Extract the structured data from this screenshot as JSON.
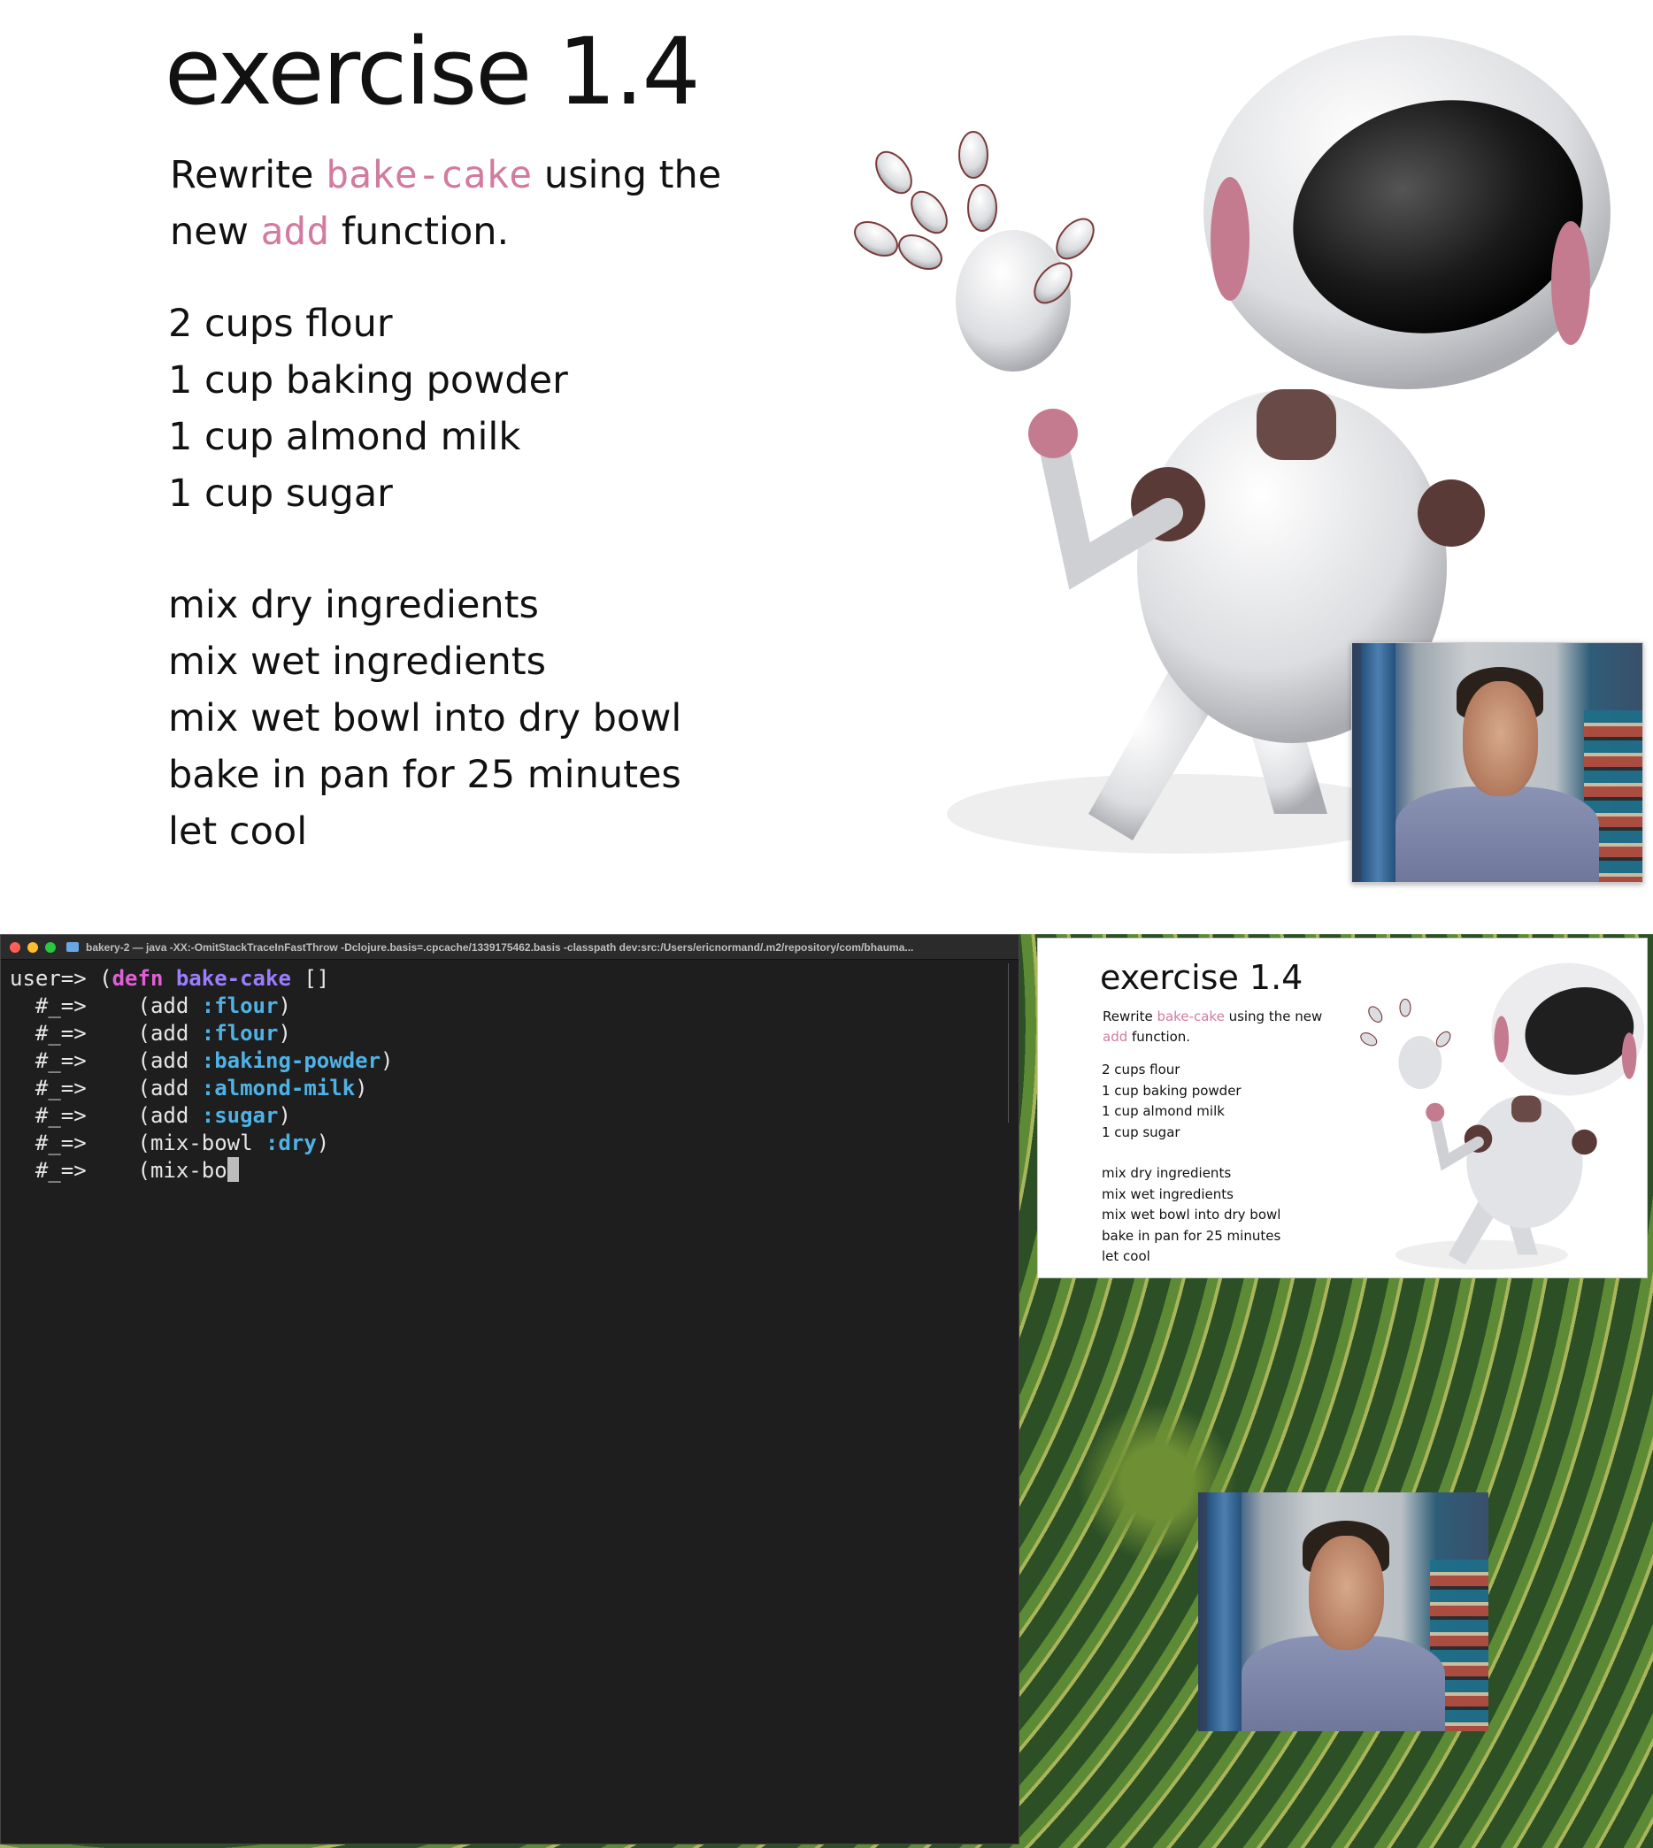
{
  "slide": {
    "title": "exercise 1.4",
    "intro_pre": "Rewrite ",
    "intro_code1": "bake-cake",
    "intro_mid": " using the new ",
    "intro_code2": "add",
    "intro_post": " function.",
    "ingredients": [
      "2 cups flour",
      "1 cup baking powder",
      "1 cup almond milk",
      "1 cup sugar"
    ],
    "steps": [
      "mix dry ingredients",
      "mix wet ingredients",
      "mix wet bowl into dry bowl",
      "bake in pan for 25 minutes",
      "let cool"
    ]
  },
  "mini_slide": {
    "title": "exercise 1.4",
    "intro_pre": "Rewrite ",
    "intro_code1": "bake-cake",
    "intro_mid": " using the new ",
    "intro_code2": "add",
    "intro_post": " function.",
    "ingredients": [
      "2 cups flour",
      "1 cup baking powder",
      "1 cup almond milk",
      "1 cup sugar"
    ],
    "steps": [
      "mix dry ingredients",
      "mix wet ingredients",
      "mix wet bowl into dry bowl",
      "bake in pan for 25 minutes",
      "let cool"
    ]
  },
  "terminal": {
    "title": "bakery-2 — java -XX:-OmitStackTraceInFastThrow -Dclojure.basis=.cpcache/1339175462.basis -classpath dev:src:/Users/ericnormand/.m2/repository/com/bhauma...",
    "prompt_user": "user=> ",
    "prompt_cont": "  #_=>    ",
    "line0": {
      "open": "(",
      "kw": "defn",
      "fn": "bake-cake",
      "rest": " []"
    },
    "lines": [
      {
        "pre": "(add ",
        "kw": ":flour",
        "post": ")"
      },
      {
        "pre": "(add ",
        "kw": ":flour",
        "post": ")"
      },
      {
        "pre": "(add ",
        "kw": ":baking-powder",
        "post": ")"
      },
      {
        "pre": "(add ",
        "kw": ":almond-milk",
        "post": ")"
      },
      {
        "pre": "(add ",
        "kw": ":sugar",
        "post": ")"
      },
      {
        "pre": "(mix-bowl ",
        "kw": ":dry",
        "post": ")"
      }
    ],
    "last_line": "(mix-bo"
  },
  "colors": {
    "accent": "#d27b9e",
    "terminal_bg": "#1e1e1e",
    "clj_keyword": "#4fb2e6",
    "clj_special": "#e05fd7",
    "clj_fn": "#9c7cff"
  },
  "icons": [
    "robot-illustration",
    "webcam-presenter",
    "folder-icon",
    "close-dot",
    "minimize-dot",
    "zoom-dot"
  ]
}
